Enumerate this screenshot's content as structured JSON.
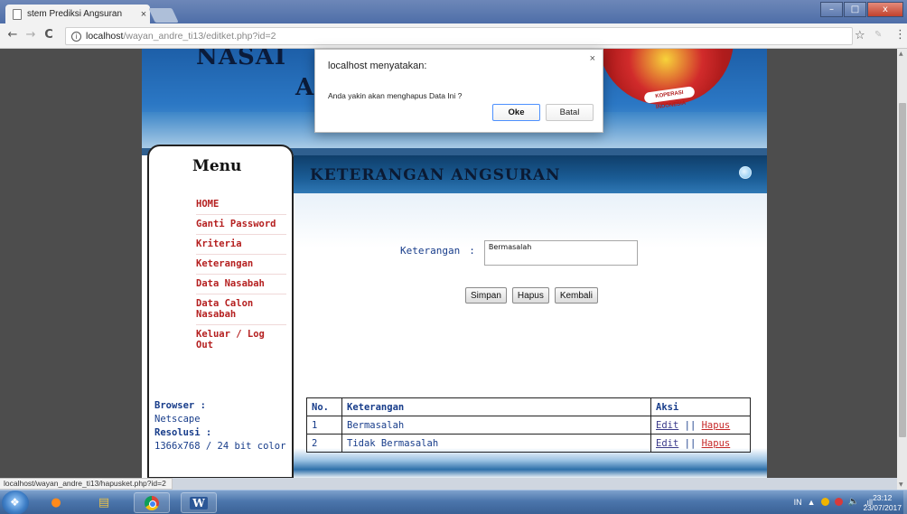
{
  "browser": {
    "tab_title": "stem Prediksi Angsuran",
    "tab_close": "×",
    "url_host": "localhost",
    "url_path": "/wayan_andre_ti13/editket.php?id=2",
    "info_glyph": "i",
    "back_glyph": "←",
    "forward_glyph": "→",
    "reload_glyph": "C",
    "star_glyph": "☆",
    "menu_glyph": "⋮",
    "status_url": "localhost/wayan_andre_ti13/hapusket.php?id=2",
    "window_buttons": {
      "minimize": "–",
      "maximize": "□",
      "close": "x"
    }
  },
  "header": {
    "title_line1": "NASAI",
    "title_line2": "A",
    "logo_band": "KOPERASI INDONESIA"
  },
  "sidebar": {
    "title": "Menu",
    "items": [
      {
        "label": "HOME"
      },
      {
        "label": "Ganti Password"
      },
      {
        "label": "Kriteria"
      },
      {
        "label": "Keterangan"
      },
      {
        "label": "Data Nasabah"
      },
      {
        "label": "Data Calon Nasabah"
      },
      {
        "label": "Keluar / Log Out"
      }
    ],
    "browser_label": "Browser :",
    "browser_value": "Netscape",
    "resolusi_label": "Resolusi :",
    "resolusi_value": "1366x768 / 24 bit color"
  },
  "main": {
    "title": "KETERANGAN ANGSURAN",
    "form": {
      "label": "Keterangan",
      "colon": ":",
      "value": "Bermasalah"
    },
    "buttons": {
      "save": "Simpan",
      "delete": "Hapus",
      "back": "Kembali"
    },
    "table": {
      "headers": [
        "No.",
        "Keterangan",
        "Aksi"
      ],
      "rows": [
        {
          "no": "1",
          "keterangan": "Bermasalah",
          "edit": "Edit",
          "sep": "||",
          "hapus": "Hapus"
        },
        {
          "no": "2",
          "keterangan": "Tidak Bermasalah",
          "edit": "Edit",
          "sep": "||",
          "hapus": "Hapus"
        }
      ]
    }
  },
  "alert": {
    "title": "localhost menyatakan:",
    "message": "Anda yakin akan menghapus Data Ini ?",
    "ok": "Oke",
    "cancel": "Batal",
    "close": "×"
  },
  "taskbar": {
    "lang": "IN",
    "time": "23:12",
    "date": "23/07/2017",
    "tray_arrow": "▲",
    "signal": ".ıll"
  },
  "colors": {
    "menu_link": "#b52020",
    "body_text": "#173c8a",
    "header_blue": "#1d5fa8"
  }
}
